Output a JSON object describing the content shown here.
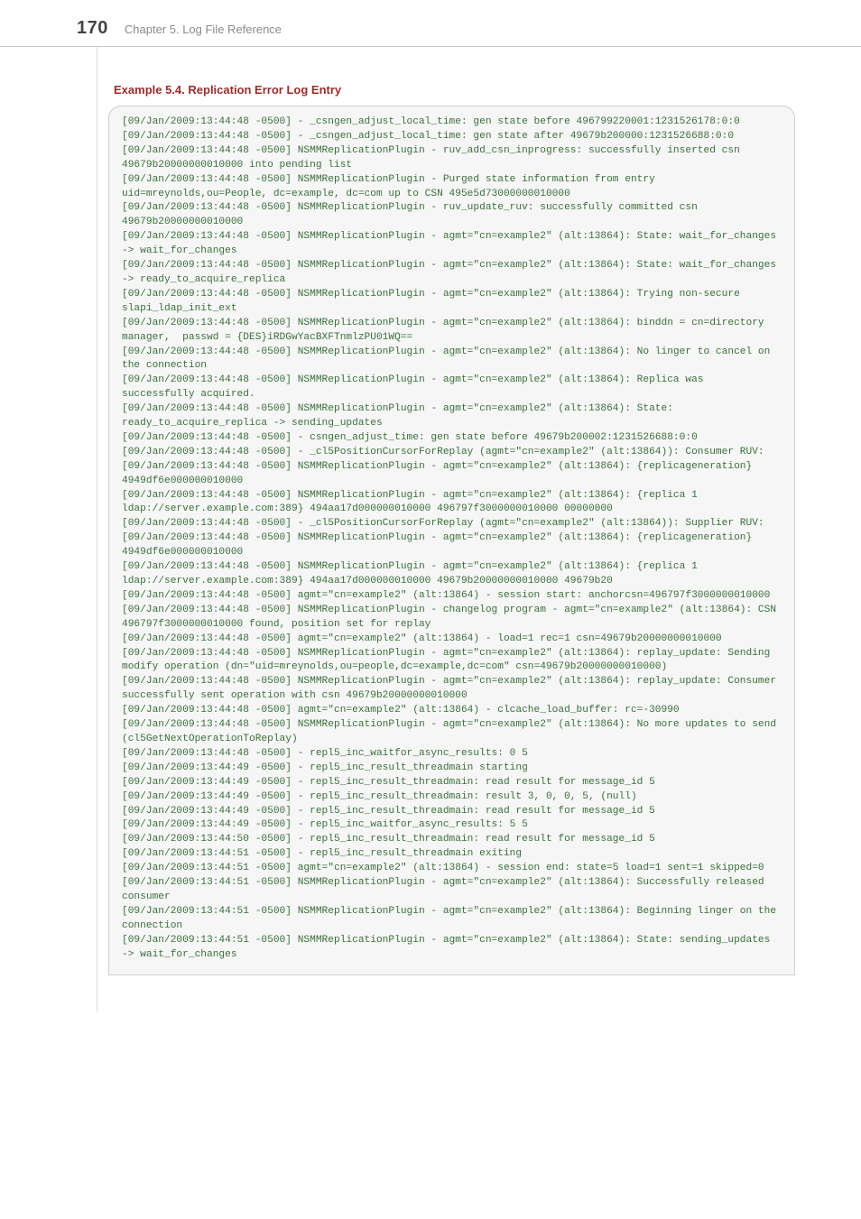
{
  "header": {
    "page_number": "170",
    "chapter_title": "Chapter 5. Log File Reference"
  },
  "example": {
    "title": "Example 5.4. Replication Error Log Entry",
    "log": "[09/Jan/2009:13:44:48 -0500] - _csngen_adjust_local_time: gen state before 496799220001:1231526178:0:0\n[09/Jan/2009:13:44:48 -0500] - _csngen_adjust_local_time: gen state after 49679b200000:1231526688:0:0\n[09/Jan/2009:13:44:48 -0500] NSMMReplicationPlugin - ruv_add_csn_inprogress: successfully inserted csn 49679b20000000010000 into pending list\n[09/Jan/2009:13:44:48 -0500] NSMMReplicationPlugin - Purged state information from entry uid=mreynolds,ou=People, dc=example, dc=com up to CSN 495e5d73000000010000\n[09/Jan/2009:13:44:48 -0500] NSMMReplicationPlugin - ruv_update_ruv: successfully committed csn 49679b20000000010000\n[09/Jan/2009:13:44:48 -0500] NSMMReplicationPlugin - agmt=\"cn=example2\" (alt:13864): State: wait_for_changes -> wait_for_changes\n[09/Jan/2009:13:44:48 -0500] NSMMReplicationPlugin - agmt=\"cn=example2\" (alt:13864): State: wait_for_changes -> ready_to_acquire_replica\n[09/Jan/2009:13:44:48 -0500] NSMMReplicationPlugin - agmt=\"cn=example2\" (alt:13864): Trying non-secure slapi_ldap_init_ext\n[09/Jan/2009:13:44:48 -0500] NSMMReplicationPlugin - agmt=\"cn=example2\" (alt:13864): binddn = cn=directory manager,  passwd = {DES}iRDGwYacBXFTnmlzPU01WQ==\n[09/Jan/2009:13:44:48 -0500] NSMMReplicationPlugin - agmt=\"cn=example2\" (alt:13864): No linger to cancel on the connection\n[09/Jan/2009:13:44:48 -0500] NSMMReplicationPlugin - agmt=\"cn=example2\" (alt:13864): Replica was successfully acquired.\n[09/Jan/2009:13:44:48 -0500] NSMMReplicationPlugin - agmt=\"cn=example2\" (alt:13864): State: ready_to_acquire_replica -> sending_updates\n[09/Jan/2009:13:44:48 -0500] - csngen_adjust_time: gen state before 49679b200002:1231526688:0:0\n[09/Jan/2009:13:44:48 -0500] - _cl5PositionCursorForReplay (agmt=\"cn=example2\" (alt:13864)): Consumer RUV:\n[09/Jan/2009:13:44:48 -0500] NSMMReplicationPlugin - agmt=\"cn=example2\" (alt:13864): {replicageneration} 4949df6e000000010000\n[09/Jan/2009:13:44:48 -0500] NSMMReplicationPlugin - agmt=\"cn=example2\" (alt:13864): {replica 1 ldap://server.example.com:389} 494aa17d000000010000 496797f3000000010000 00000000\n[09/Jan/2009:13:44:48 -0500] - _cl5PositionCursorForReplay (agmt=\"cn=example2\" (alt:13864)): Supplier RUV:\n[09/Jan/2009:13:44:48 -0500] NSMMReplicationPlugin - agmt=\"cn=example2\" (alt:13864): {replicageneration} 4949df6e000000010000\n[09/Jan/2009:13:44:48 -0500] NSMMReplicationPlugin - agmt=\"cn=example2\" (alt:13864): {replica 1 ldap://server.example.com:389} 494aa17d000000010000 49679b20000000010000 49679b20\n[09/Jan/2009:13:44:48 -0500] agmt=\"cn=example2\" (alt:13864) - session start: anchorcsn=496797f3000000010000\n[09/Jan/2009:13:44:48 -0500] NSMMReplicationPlugin - changelog program - agmt=\"cn=example2\" (alt:13864): CSN 496797f3000000010000 found, position set for replay\n[09/Jan/2009:13:44:48 -0500] agmt=\"cn=example2\" (alt:13864) - load=1 rec=1 csn=49679b20000000010000\n[09/Jan/2009:13:44:48 -0500] NSMMReplicationPlugin - agmt=\"cn=example2\" (alt:13864): replay_update: Sending modify operation (dn=\"uid=mreynolds,ou=people,dc=example,dc=com\" csn=49679b20000000010000)\n[09/Jan/2009:13:44:48 -0500] NSMMReplicationPlugin - agmt=\"cn=example2\" (alt:13864): replay_update: Consumer successfully sent operation with csn 49679b20000000010000\n[09/Jan/2009:13:44:48 -0500] agmt=\"cn=example2\" (alt:13864) - clcache_load_buffer: rc=-30990\n[09/Jan/2009:13:44:48 -0500] NSMMReplicationPlugin - agmt=\"cn=example2\" (alt:13864): No more updates to send (cl5GetNextOperationToReplay)\n[09/Jan/2009:13:44:48 -0500] - repl5_inc_waitfor_async_results: 0 5\n[09/Jan/2009:13:44:49 -0500] - repl5_inc_result_threadmain starting\n[09/Jan/2009:13:44:49 -0500] - repl5_inc_result_threadmain: read result for message_id 5\n[09/Jan/2009:13:44:49 -0500] - repl5_inc_result_threadmain: result 3, 0, 0, 5, (null)\n[09/Jan/2009:13:44:49 -0500] - repl5_inc_result_threadmain: read result for message_id 5\n[09/Jan/2009:13:44:49 -0500] - repl5_inc_waitfor_async_results: 5 5\n[09/Jan/2009:13:44:50 -0500] - repl5_inc_result_threadmain: read result for message_id 5\n[09/Jan/2009:13:44:51 -0500] - repl5_inc_result_threadmain exiting\n[09/Jan/2009:13:44:51 -0500] agmt=\"cn=example2\" (alt:13864) - session end: state=5 load=1 sent=1 skipped=0\n[09/Jan/2009:13:44:51 -0500] NSMMReplicationPlugin - agmt=\"cn=example2\" (alt:13864): Successfully released consumer\n[09/Jan/2009:13:44:51 -0500] NSMMReplicationPlugin - agmt=\"cn=example2\" (alt:13864): Beginning linger on the connection\n[09/Jan/2009:13:44:51 -0500] NSMMReplicationPlugin - agmt=\"cn=example2\" (alt:13864): State: sending_updates -> wait_for_changes"
  }
}
